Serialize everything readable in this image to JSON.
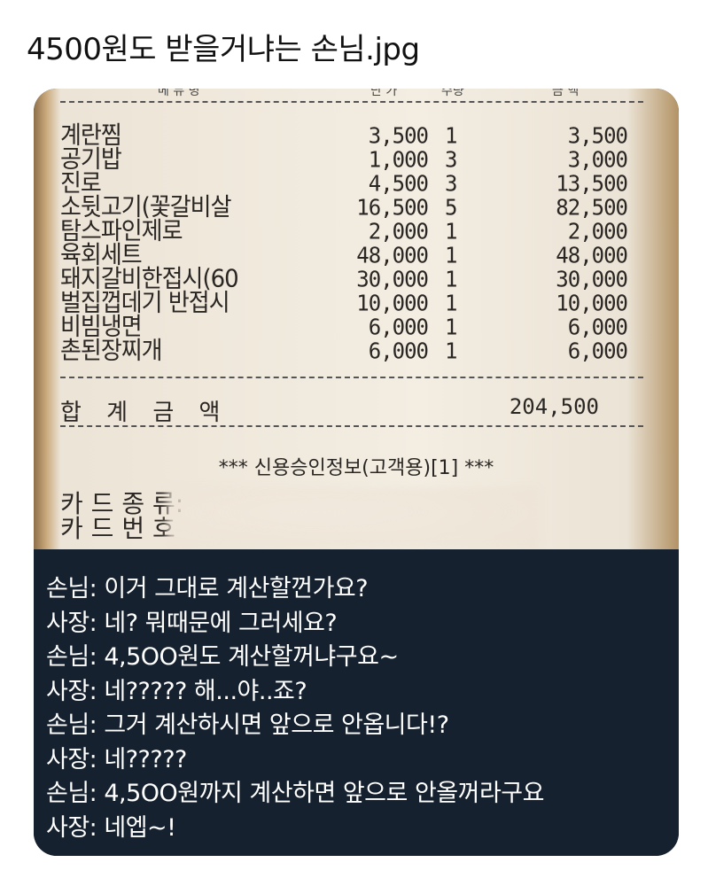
{
  "post": {
    "title": "4500원도 받을거냐는 손님.jpg"
  },
  "receipt": {
    "header_fragments": [
      "메 뉴 명",
      "단 가",
      "수량",
      "금 액"
    ],
    "items": [
      {
        "name": "계란찜",
        "price": "3,500",
        "qty": "1",
        "amount": "3,500"
      },
      {
        "name": "공기밥",
        "price": "1,000",
        "qty": "3",
        "amount": "3,000"
      },
      {
        "name": "진로",
        "price": "4,500",
        "qty": "3",
        "amount": "13,500"
      },
      {
        "name": "소뒷고기(꽃갈비살",
        "price": "16,500",
        "qty": "5",
        "amount": "82,500"
      },
      {
        "name": "탐스파인제로",
        "price": "2,000",
        "qty": "1",
        "amount": "2,000"
      },
      {
        "name": "육회세트",
        "price": "48,000",
        "qty": "1",
        "amount": "48,000"
      },
      {
        "name": "돼지갈비한접시(60",
        "price": "30,000",
        "qty": "1",
        "amount": "30,000"
      },
      {
        "name": "벌집껍데기 반접시",
        "price": "10,000",
        "qty": "1",
        "amount": "10,000"
      },
      {
        "name": "비빔냉면",
        "price": "6,000",
        "qty": "1",
        "amount": "6,000"
      },
      {
        "name": "촌된장찌개",
        "price": "6,000",
        "qty": "1",
        "amount": "6,000"
      }
    ],
    "total_label": "합 계 금 액",
    "total_value": "204,500",
    "card_info_title": "*** 신용승인정보(고객용)[1] ***",
    "card_lines": [
      "카 드 종 류:",
      "카 드 번 호"
    ]
  },
  "dialogue": [
    "손님: 이거 그대로 계산할껀가요?",
    "사장: 네? 뭐때문에 그러세요?",
    "손님: 4,5OO원도 계산할꺼냐구요~",
    "사장: 네????? 해...야..죠?",
    "손님: 그거 계산하시면 앞으로 안옵니다!?",
    "사장: 네?????",
    "손님: 4,5OO원까지 계산하면 앞으로 안올꺼라구요",
    "사장: 네엡~!"
  ]
}
